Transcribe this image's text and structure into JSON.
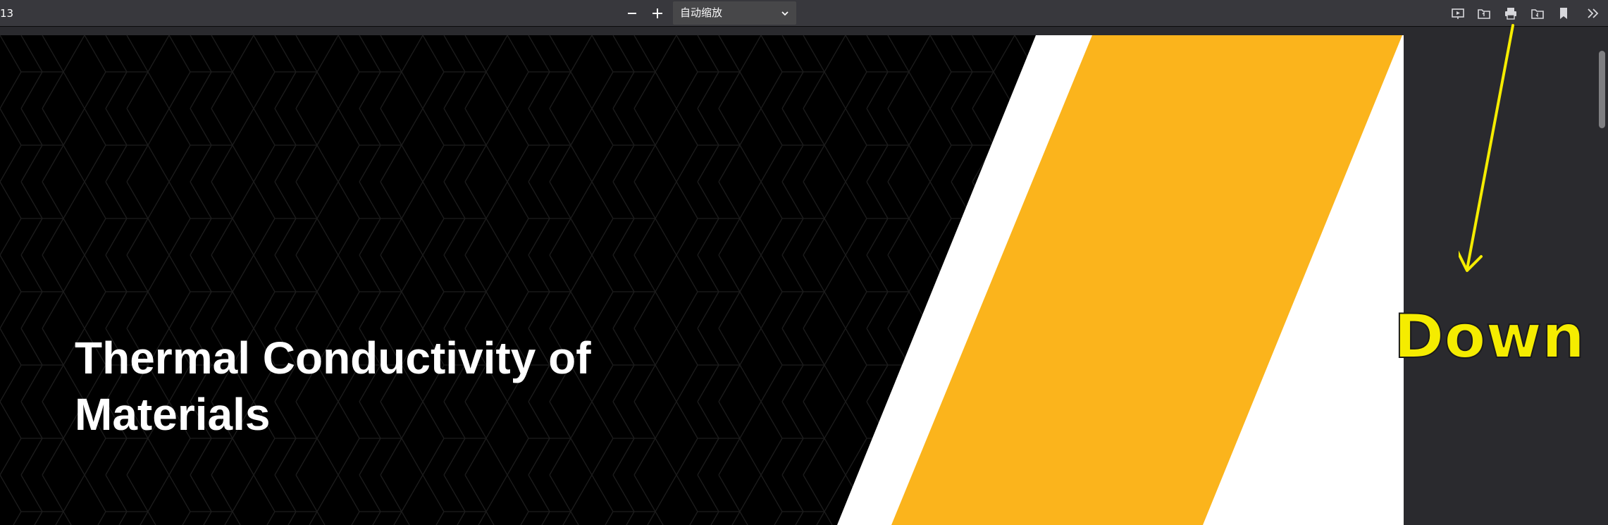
{
  "toolbar": {
    "page_number_fragment": "13",
    "zoom_out_icon": "minus-icon",
    "zoom_in_icon": "plus-icon",
    "zoom_value": "自动缩放",
    "right_icons": [
      "presentation-mode-icon",
      "open-file-icon",
      "print-icon",
      "download-icon",
      "bookmark-icon",
      "more-tools-icon"
    ]
  },
  "slide": {
    "title_line1": "Thermal Conductivity of",
    "title_line2": "Materials",
    "colors": {
      "background": "#000000",
      "stripe_white": "#ffffff",
      "stripe_yellow": "#fbb41c"
    }
  },
  "annotation": {
    "text": "Down",
    "color": "#f5ec00",
    "arrow_icon": "arrow-down-icon"
  }
}
